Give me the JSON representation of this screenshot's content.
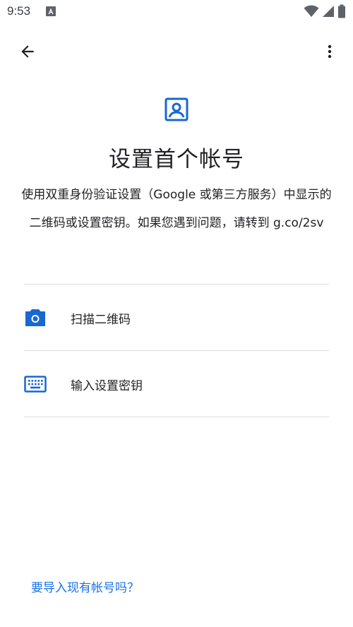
{
  "status_bar": {
    "time": "9:53"
  },
  "header": {
    "title": "设置首个帐号",
    "description": "使用双重身份验证设置（Google 或第三方服务）中显示的二维码或设置密钥。如果您遇到问题，请转到 g.co/2sv"
  },
  "options": [
    {
      "label": "扫描二维码",
      "icon": "camera-icon"
    },
    {
      "label": "输入设置密钥",
      "icon": "keyboard-icon"
    }
  ],
  "footer": {
    "import_link": "要导入现有帐号吗？"
  },
  "colors": {
    "accent": "#1a73e8",
    "icon_blue": "#1967d2",
    "text": "#202124",
    "divider": "#dadce0"
  }
}
